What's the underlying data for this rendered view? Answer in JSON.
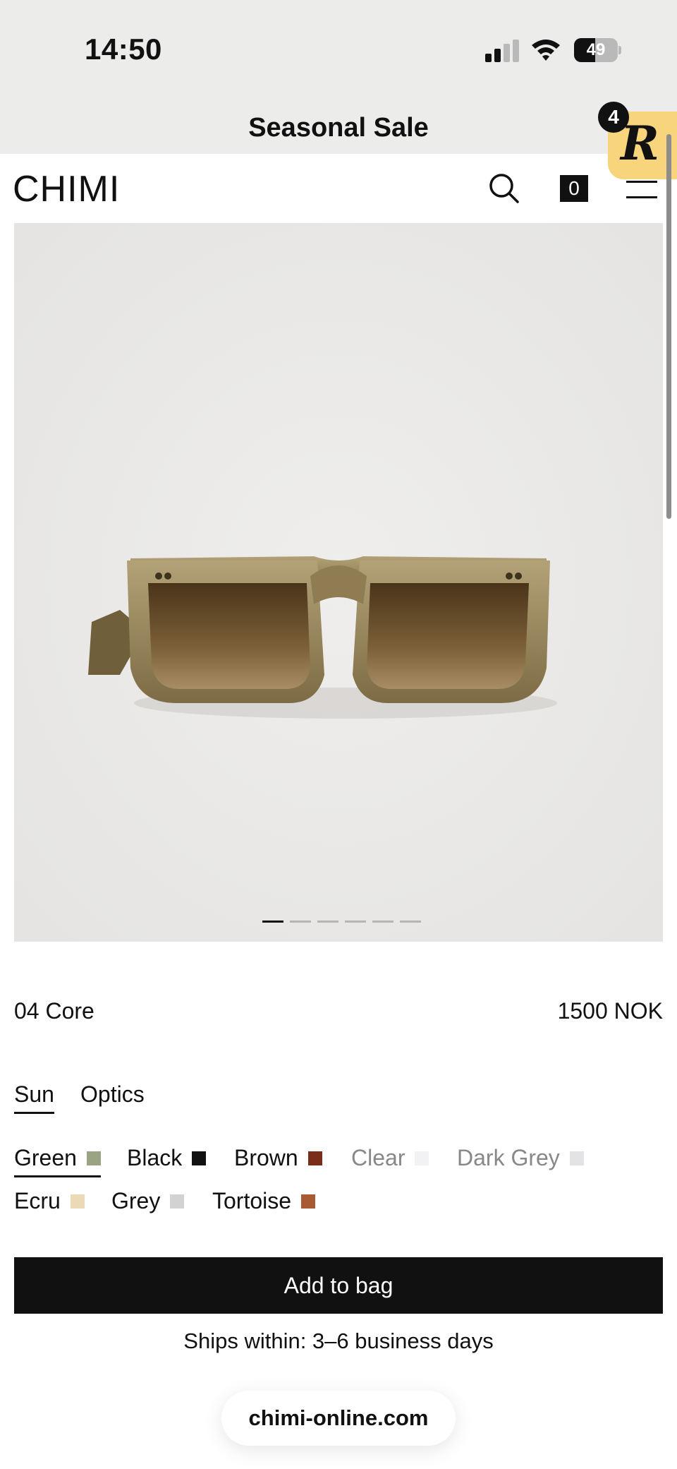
{
  "status_bar": {
    "time": "14:50",
    "battery_level": "49",
    "battery_fraction": 0.49,
    "signal_icon": "cellular-signal-icon",
    "wifi_icon": "wifi-icon"
  },
  "promo": {
    "text": "Seasonal Sale"
  },
  "floating_badge": {
    "letter": "R",
    "count": "4",
    "color": "#f8d57c"
  },
  "header": {
    "brand": "CHIMI",
    "search_icon": "search-icon",
    "cart_count": "0",
    "menu_icon": "hamburger-menu-icon"
  },
  "gallery": {
    "image": "green-sunglasses-product-photo",
    "slide_count": 6,
    "active_slide": 1
  },
  "product": {
    "name": "04 Core",
    "price": "1500 NOK"
  },
  "type_tabs": [
    {
      "label": "Sun",
      "active": true
    },
    {
      "label": "Optics",
      "active": false
    }
  ],
  "colors": [
    {
      "label": "Green",
      "swatch": "#9aa384",
      "selected": true,
      "available": true
    },
    {
      "label": "Black",
      "swatch": "#111111",
      "selected": false,
      "available": true
    },
    {
      "label": "Brown",
      "swatch": "#7a2e1a",
      "selected": false,
      "available": true
    },
    {
      "label": "Clear",
      "swatch": "#f2f2f4",
      "selected": false,
      "available": false
    },
    {
      "label": "Dark Grey",
      "swatch": "#e3e3e5",
      "selected": false,
      "available": false
    },
    {
      "label": "Ecru",
      "swatch": "#ecd9b6",
      "selected": false,
      "available": true
    },
    {
      "label": "Grey",
      "swatch": "#d2d2d2",
      "selected": false,
      "available": true
    },
    {
      "label": "Tortoise",
      "swatch": "#a85a34",
      "selected": false,
      "available": true
    }
  ],
  "add_to_bag": {
    "label": "Add to bag"
  },
  "shipping": {
    "text": "Ships within: 3–6 business days"
  },
  "browser": {
    "url": "chimi-online.com"
  }
}
